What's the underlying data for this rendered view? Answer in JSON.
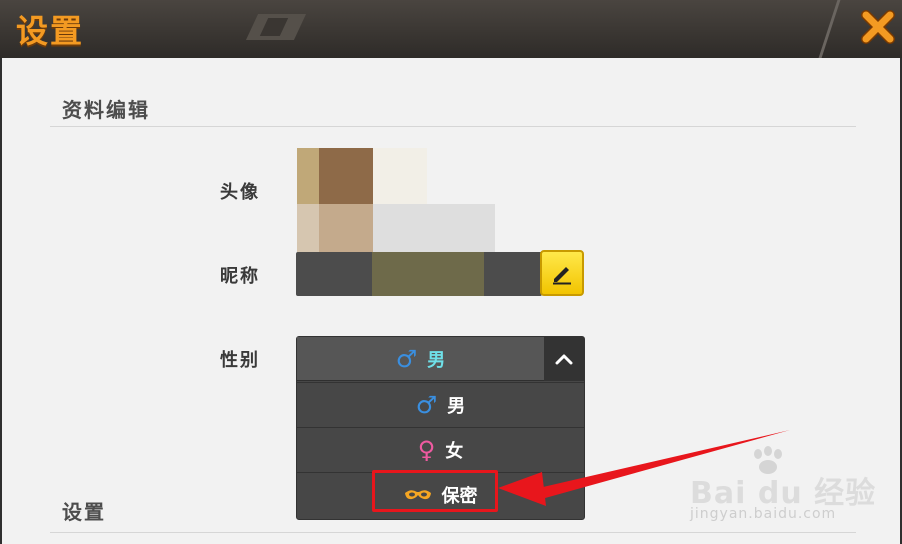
{
  "header": {
    "title": "设置"
  },
  "profile": {
    "section_title": "资料编辑",
    "avatar_label": "头像",
    "nickname_label": "昵称",
    "gender_label": "性别"
  },
  "gender_dropdown": {
    "selected": {
      "symbol": "♂",
      "label": "男"
    },
    "options": [
      {
        "symbol": "♂",
        "label": "男"
      },
      {
        "symbol": "♀",
        "label": "女"
      },
      {
        "symbol": "mask",
        "label": "保密"
      }
    ]
  },
  "settings": {
    "section_title": "设置"
  },
  "watermark": {
    "brand": "Bai du 经验",
    "url": "jingyan.baidu.com"
  },
  "colors": {
    "accent": "#f39a22",
    "male": "#3a8fe0",
    "female": "#ee5aa0",
    "secret": "#f5a623",
    "highlight": "#e8161c",
    "edit_button": "#f2c400"
  }
}
